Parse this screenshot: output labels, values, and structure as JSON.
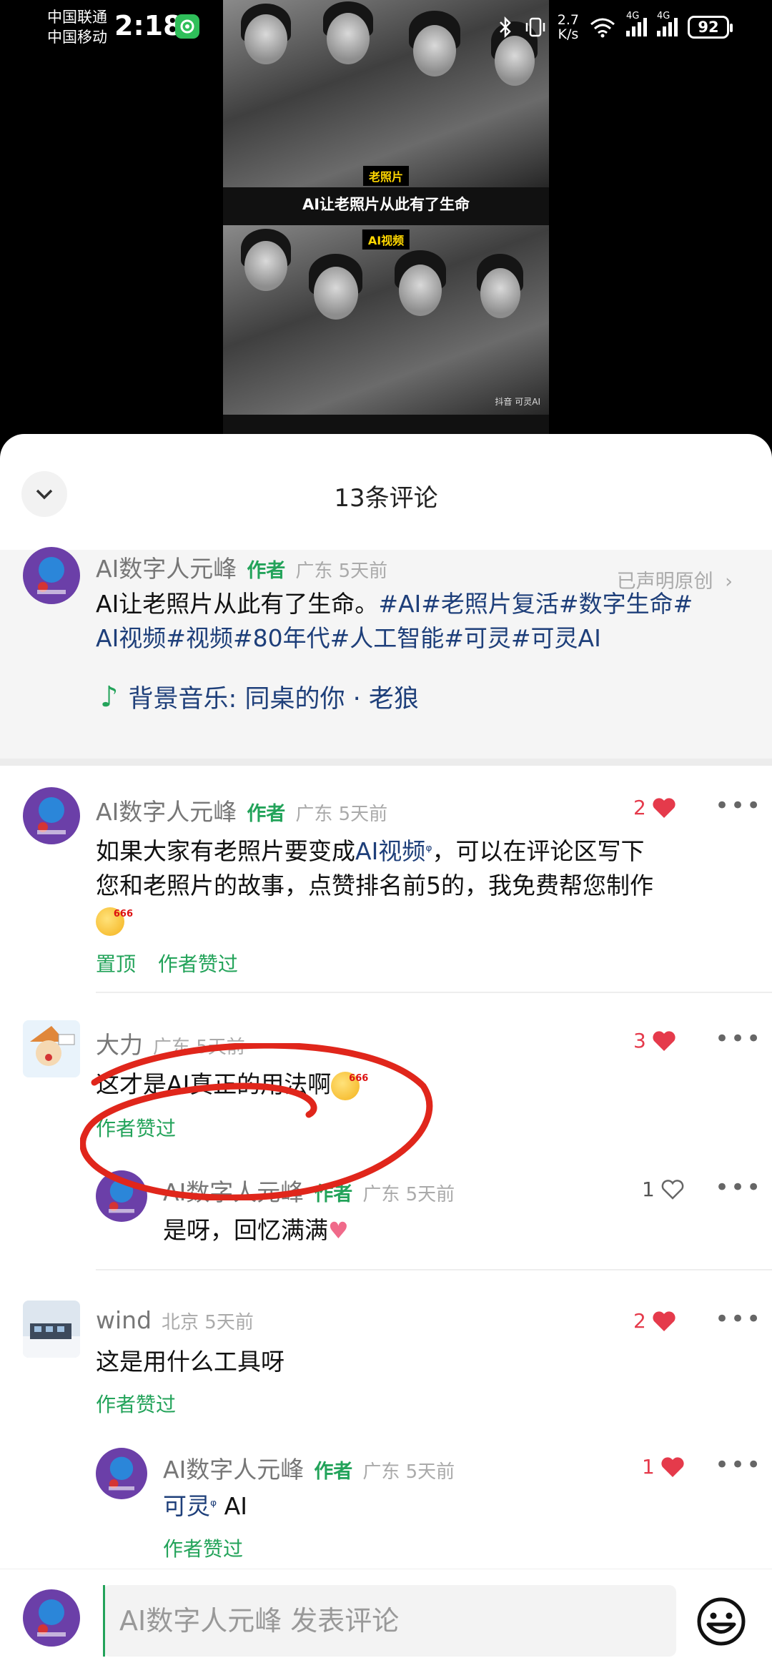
{
  "status_bar": {
    "carrier1": "中国联通",
    "carrier2": "中国移动",
    "time": "2:18",
    "net_speed_top": "2.7",
    "net_speed_bottom": "K/s",
    "signal1": "4G",
    "signal2": "4G",
    "battery": "92"
  },
  "video": {
    "tag_top": "老照片",
    "caption": "AI让老照片从此有了生命",
    "tag_bottom": "AI视频",
    "watermark": "抖音 可灵AI"
  },
  "sheet": {
    "title": "13条评论"
  },
  "post": {
    "author": "AI数字人元峰",
    "author_tag": "作者",
    "location": "广东 5天前",
    "declared": "已声明原创",
    "text_plain": "AI让老照片从此有了生命。",
    "hashtags_line1": "#AI#老照片复活#数字生命#",
    "hashtags_line2": "AI视频#视频#80年代#人工智能#可灵#可灵AI",
    "music": "背景音乐: 同桌的你 · 老狼"
  },
  "comments": [
    {
      "user": "AI数字人元峰",
      "author_tag": "作者",
      "location": "广东 5天前",
      "likes": "2",
      "text_a": "如果大家有老照片要变成",
      "text_link": "AI视频",
      "text_b": "，可以在评论区写下",
      "text_line2": "您和老照片的故事，点赞排名前5的，我免费帮您制作",
      "pinned": "置顶",
      "liked_by_author": "作者赞过"
    },
    {
      "user": "大力",
      "location": "广东 5天前",
      "likes": "3",
      "text": "这才是AI真正的用法啊",
      "liked_by_author": "作者赞过",
      "reply": {
        "user": "AI数字人元峰",
        "author_tag": "作者",
        "location": "广东 5天前",
        "likes": "1",
        "text": "是呀，回忆满满"
      }
    },
    {
      "user": "wind",
      "location": "北京 5天前",
      "likes": "2",
      "text": "这是用什么工具呀",
      "liked_by_author": "作者赞过",
      "reply": {
        "user": "AI数字人元峰",
        "author_tag": "作者",
        "location": "广东 5天前",
        "likes": "1",
        "text_link": "可灵",
        "text_tail": " AI",
        "liked_by_author": "作者赞过"
      }
    }
  ],
  "input": {
    "placeholder": "AI数字人元峰 发表评论"
  },
  "colors": {
    "accent_green": "#23a35a",
    "like_red": "#e53a4b",
    "link_blue": "#1e3f7a",
    "annotation_red": "#e0261b"
  }
}
